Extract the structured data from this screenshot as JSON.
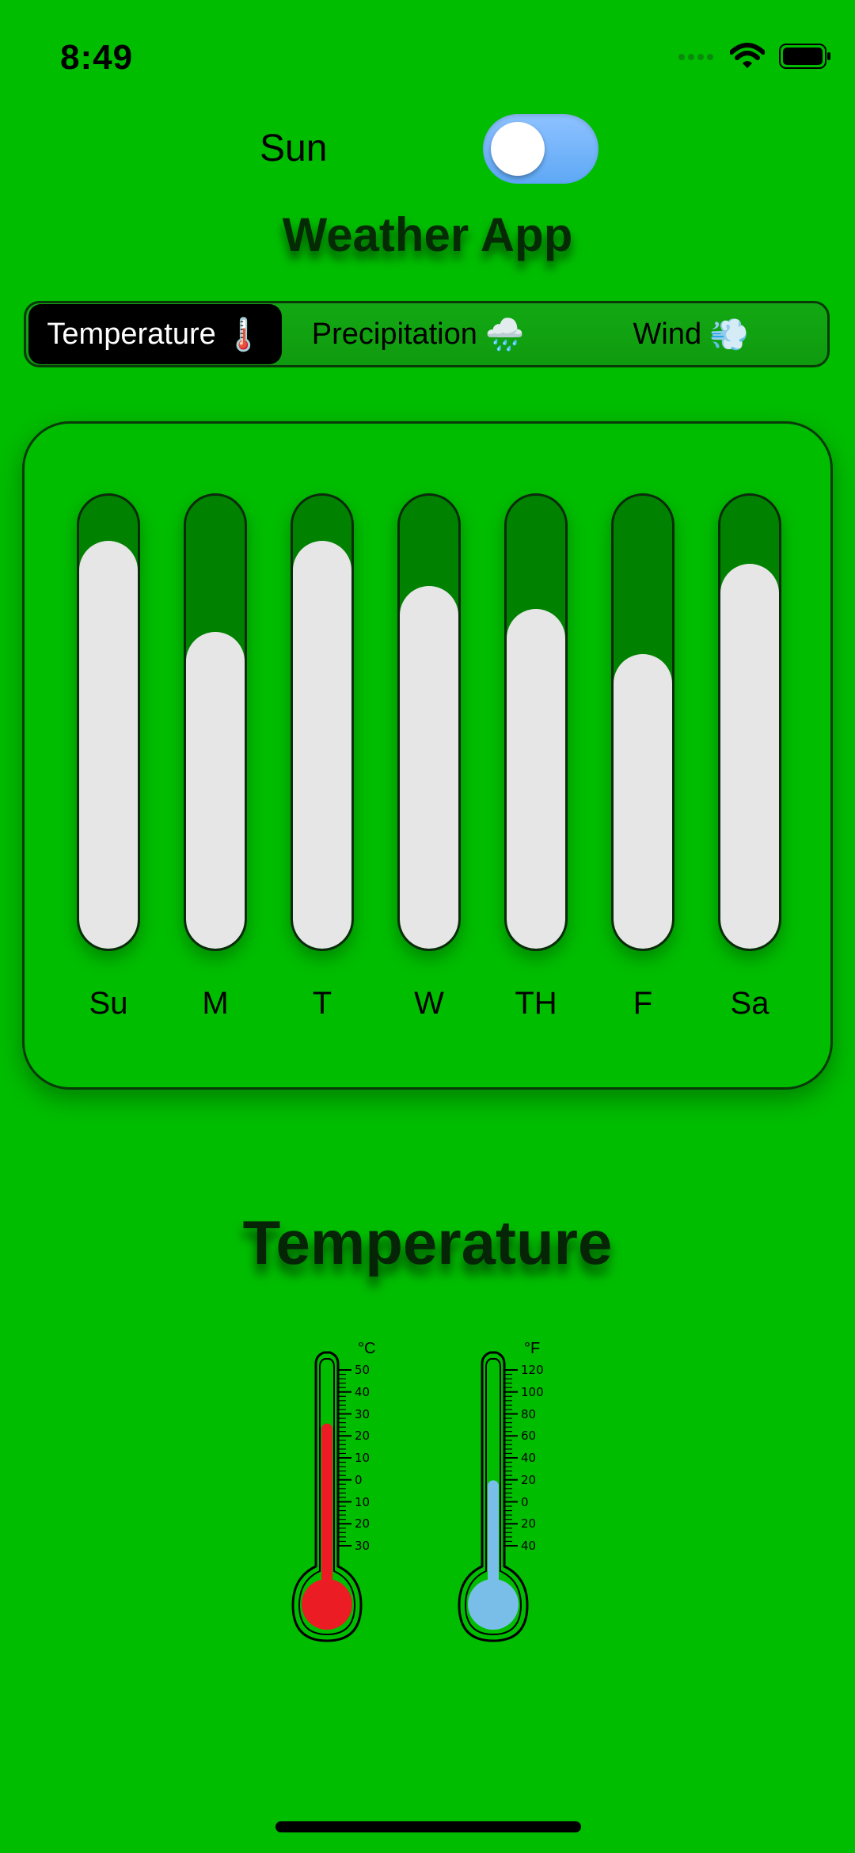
{
  "status_bar": {
    "time": "8:49",
    "icons": [
      "signal-dots-icon",
      "wifi-icon",
      "battery-icon"
    ]
  },
  "toggle": {
    "label": "Sun",
    "state": "on",
    "color": "#6fb1ff"
  },
  "app_title": "Weather App",
  "tabs": [
    {
      "label": "Temperature",
      "emoji": "🌡️",
      "active": true
    },
    {
      "label": "Precipitation",
      "emoji": "🌧️",
      "active": false
    },
    {
      "label": "Wind",
      "emoji": "💨",
      "active": false
    }
  ],
  "chart_data": {
    "type": "bar",
    "categories": [
      "Su",
      "M",
      "T",
      "W",
      "TH",
      "F",
      "Sa"
    ],
    "values": [
      0.9,
      0.7,
      0.9,
      0.8,
      0.75,
      0.65,
      0.85
    ],
    "ylim": [
      0,
      1
    ],
    "track_color": "#008200",
    "fill_color": "#e6e6e6"
  },
  "section_title": "Temperature",
  "thermometers": {
    "celsius": {
      "unit": "°C",
      "ticks": [
        "50",
        "40",
        "30",
        "20",
        "10",
        "0",
        "10",
        "20",
        "30"
      ],
      "level": 0.72,
      "color": "#ec1c24"
    },
    "fahrenheit": {
      "unit": "°F",
      "ticks": [
        "120",
        "100",
        "80",
        "60",
        "40",
        "20",
        "0",
        "20",
        "40"
      ],
      "level": 0.44,
      "color": "#79bde9"
    }
  },
  "colors": {
    "background": "#00bd00",
    "active_tab": "#000000"
  }
}
